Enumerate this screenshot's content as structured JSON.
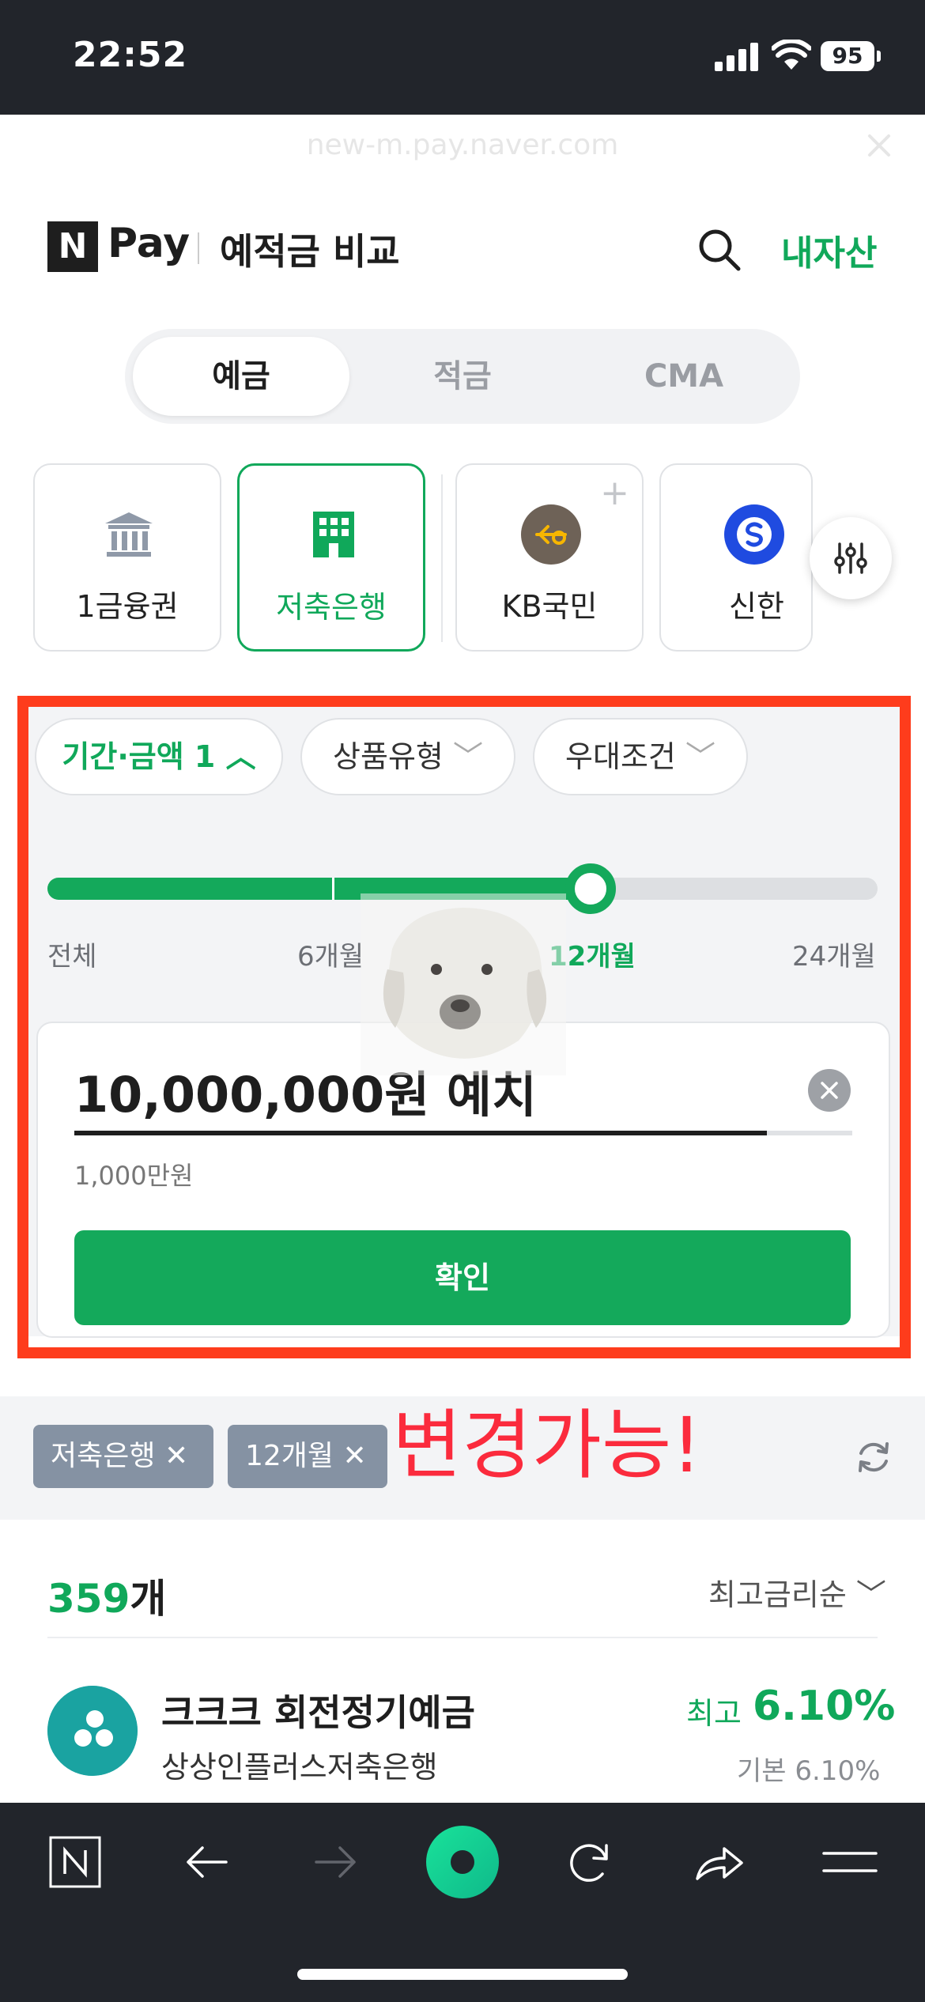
{
  "status": {
    "time": "22:52",
    "battery": "95"
  },
  "browser": {
    "url": "new-m.pay.naver.com"
  },
  "header": {
    "logo_letter": "N",
    "brand": "Pay",
    "title": "예적금 비교",
    "my_assets": "내자산"
  },
  "tabs": [
    {
      "label": "예금",
      "active": true
    },
    {
      "label": "적금",
      "active": false
    },
    {
      "label": "CMA",
      "active": false
    }
  ],
  "banks": [
    {
      "label": "1금융권",
      "icon": "bank-building-icon"
    },
    {
      "label": "저축은행",
      "icon": "building-icon",
      "active": true
    },
    {
      "label": "KB국민",
      "icon": "kb-logo-icon"
    },
    {
      "label": "신한",
      "icon": "shinhan-logo-icon"
    }
  ],
  "filters": {
    "chips": [
      "기간·금액 1",
      "상품유형",
      "우대조건"
    ],
    "period_labels": [
      "전체",
      "6개월",
      "12개월",
      "24개월"
    ],
    "selected_period": "12개월",
    "slider_position": 0.654,
    "amount_value": "10,000,000원 예치",
    "amount_sub": "1,000만원",
    "confirm_label": "확인"
  },
  "selected_tags": [
    "저축은행",
    "12개월"
  ],
  "annotation": "변경가능!",
  "list": {
    "count": "359",
    "count_suffix": "개",
    "sort_label": "최고금리순",
    "items": [
      {
        "name": "크크크 회전정기예금",
        "bank": "상상인플러스저축은행",
        "max_label": "최고",
        "max_rate": "6.10%",
        "base_rate": "기본 6.10%"
      }
    ]
  },
  "colors": {
    "accent": "#10a85a",
    "annotation_red": "#fb2b3d",
    "highlight_box": "#fe3c1c",
    "bar_dark": "#22252b"
  }
}
